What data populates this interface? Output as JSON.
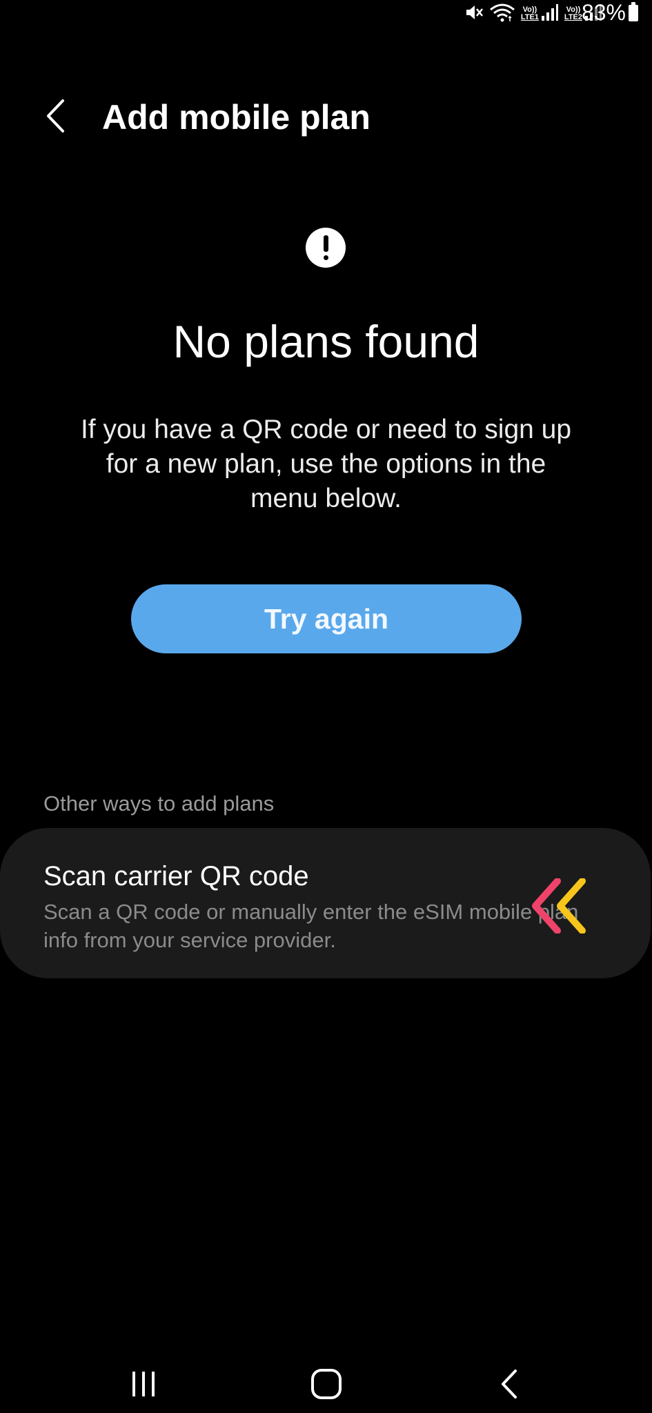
{
  "status_bar": {
    "battery_percent": "83%",
    "sim1_label": "LTE1",
    "sim2_label": "LTE2",
    "volte_label": "Vo))",
    "icons": [
      "mute-icon",
      "wifi-icon",
      "signal-icon",
      "battery-icon"
    ]
  },
  "header": {
    "title": "Add mobile plan",
    "back_icon": "back-chevron-icon"
  },
  "main": {
    "alert_icon": "exclamation-circle-icon",
    "heading": "No plans found",
    "description": "If you have a QR code or need to sign up for a new plan, use the options in the menu below.",
    "try_again_label": "Try again",
    "try_again_color": "#5aa8ec"
  },
  "other_ways": {
    "section_label": "Other ways to add plans",
    "items": [
      {
        "title": "Scan carrier QR code",
        "description": "Scan a QR code or manually enter the eSIM mobile plan info from your service provider."
      }
    ],
    "pointer_colors": [
      "#f0436a",
      "#f7c51b"
    ]
  },
  "nav_bar": {
    "icons": [
      "recent-apps-icon",
      "home-icon",
      "back-icon"
    ]
  }
}
